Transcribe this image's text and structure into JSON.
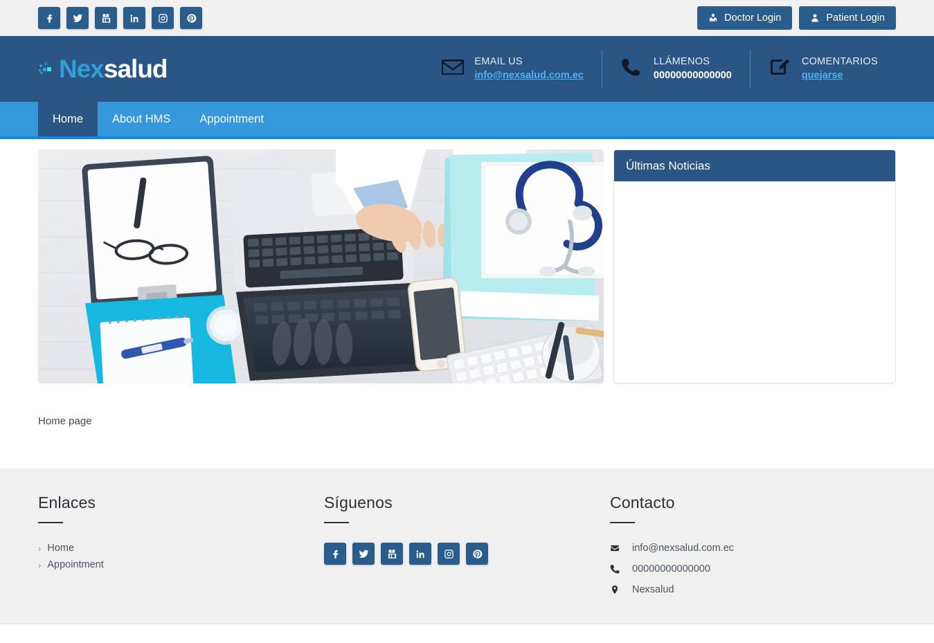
{
  "topbar": {
    "social": [
      {
        "name": "facebook",
        "label": "Facebook"
      },
      {
        "name": "twitter",
        "label": "Twitter"
      },
      {
        "name": "youtube",
        "label": "YouTube"
      },
      {
        "name": "linkedin",
        "label": "LinkedIn"
      },
      {
        "name": "instagram",
        "label": "Instagram"
      },
      {
        "name": "pinterest",
        "label": "Pinterest"
      }
    ],
    "doctor_login": "Doctor Login",
    "patient_login": "Patient Login"
  },
  "header": {
    "logo_nex": "Nex",
    "logo_salud": "salud",
    "contacts": [
      {
        "label": "EMAIL US",
        "value": "info@nexsalud.com.ec",
        "icon": "envelope-icon",
        "style": "link"
      },
      {
        "label": "LLÁMENOS",
        "value": "00000000000000",
        "icon": "phone-icon",
        "style": "strong"
      },
      {
        "label": "COMENTARIOS",
        "value": "quejarse",
        "icon": "edit-icon",
        "style": "link"
      }
    ]
  },
  "nav": {
    "items": [
      {
        "label": "Home",
        "active": true
      },
      {
        "label": "About HMS",
        "active": false
      },
      {
        "label": "Appointment",
        "active": false
      }
    ]
  },
  "main": {
    "hero_alt": "doctor desk with laptop clipboard stethoscope",
    "news_title": "Últimas Noticias",
    "news_items": [],
    "page_label": "Home page"
  },
  "footer": {
    "links_title": "Enlaces",
    "links": [
      {
        "label": "Home"
      },
      {
        "label": "Appointment"
      }
    ],
    "chevron": "›",
    "follow_title": "Síguenos",
    "social": [
      {
        "name": "facebook",
        "label": "Facebook"
      },
      {
        "name": "twitter",
        "label": "Twitter"
      },
      {
        "name": "youtube",
        "label": "YouTube"
      },
      {
        "name": "linkedin",
        "label": "LinkedIn"
      },
      {
        "name": "instagram",
        "label": "Instagram"
      },
      {
        "name": "pinterest",
        "label": "Pinterest"
      }
    ],
    "contact_title": "Contacto",
    "contacts": [
      {
        "icon": "envelope-icon",
        "value": "info@nexsalud.com.ec"
      },
      {
        "icon": "phone-icon",
        "value": "00000000000000"
      },
      {
        "icon": "map-pin-icon",
        "value": "Nexsalud"
      }
    ]
  },
  "colors": {
    "header_blue": "#2a5585",
    "nav_blue": "#3498db",
    "nav_border": "#0d8ae8",
    "social_blue": "#2b5d8c",
    "link_blue": "#49b4f0",
    "footer_gray": "#f0f0f0"
  }
}
